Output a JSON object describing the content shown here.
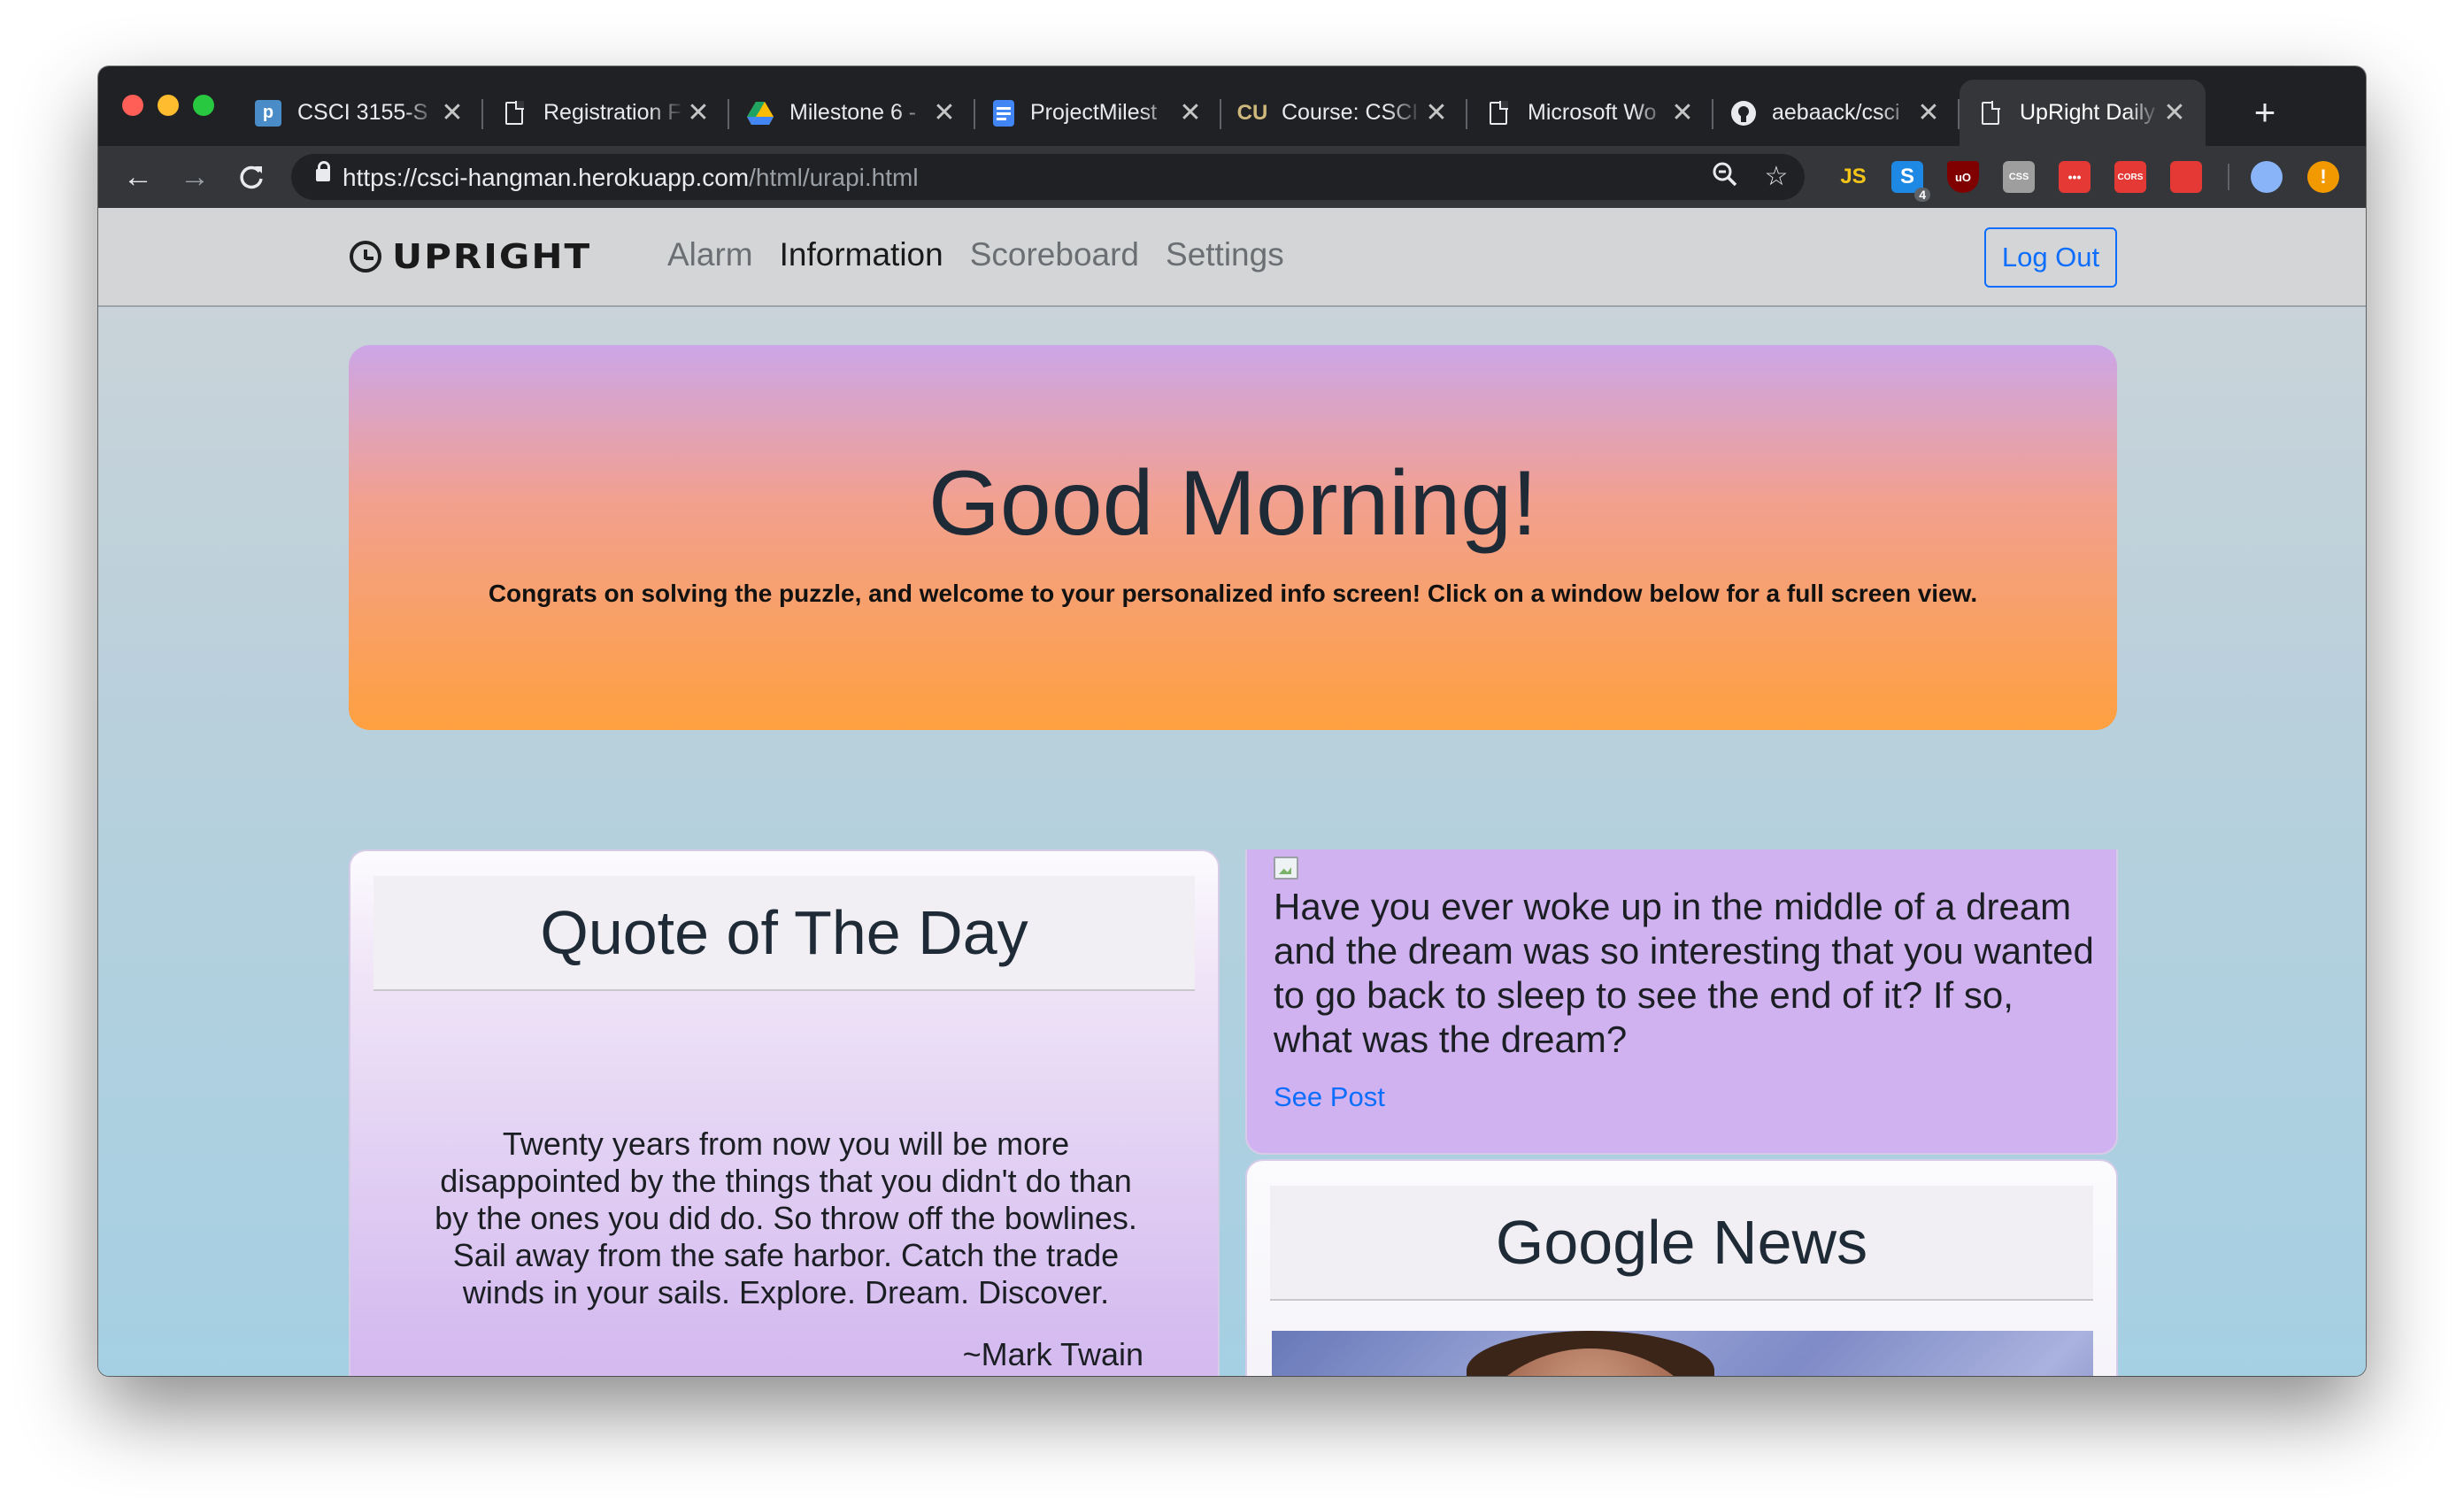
{
  "browser": {
    "tabs": [
      {
        "title": "CSCI 3155-S",
        "icon": "piazza-icon",
        "active": false
      },
      {
        "title": "Registration F",
        "icon": "document-icon",
        "active": false
      },
      {
        "title": "Milestone 6 -",
        "icon": "google-drive-icon",
        "active": false
      },
      {
        "title": "ProjectMilest",
        "icon": "google-docs-icon",
        "active": false
      },
      {
        "title": "Course: CSCI",
        "icon": "cu-boulder-icon",
        "active": false
      },
      {
        "title": "Microsoft Wo",
        "icon": "document-icon",
        "active": false
      },
      {
        "title": "aebaack/csci",
        "icon": "github-icon",
        "active": false
      },
      {
        "title": "UpRight Daily",
        "icon": "document-icon",
        "active": true
      }
    ],
    "tab_close_glyph": "✕",
    "new_tab_glyph": "+",
    "url_host": "https://csci-hangman.herokuapp.com",
    "url_path": "/html/urapi.html",
    "extensions": [
      {
        "name": "js-extension-icon",
        "label": "JS",
        "color": "#f5c518"
      },
      {
        "name": "s-extension-icon",
        "label": "S",
        "badge": "4",
        "color": "#1e88e5"
      },
      {
        "name": "ublock-icon",
        "label": "uO",
        "color": "#800000"
      },
      {
        "name": "css-extension-icon",
        "label": "CSS",
        "color": "#9e9e9e"
      },
      {
        "name": "more-extension-icon",
        "label": "•••",
        "color": "#e53935"
      },
      {
        "name": "cors-extension-icon",
        "label": "CORS",
        "color": "#e53935"
      },
      {
        "name": "red-extension-icon",
        "label": "",
        "color": "#e53935"
      }
    ]
  },
  "navbar": {
    "brand": "UPRIGHT",
    "links": [
      {
        "label": "Alarm",
        "active": false
      },
      {
        "label": "Information",
        "active": true
      },
      {
        "label": "Scoreboard",
        "active": false
      },
      {
        "label": "Settings",
        "active": false
      }
    ],
    "logout_label": "Log Out"
  },
  "hero": {
    "title": "Good Morning!",
    "subtitle": "Congrats on solving the puzzle, and welcome to your personalized info screen! Click on a window below for a full screen view."
  },
  "quote_card": {
    "heading": "Quote of The Day",
    "quote": "Twenty years from now you will be more disappointed by the things that you didn't do than by the ones you did do. So throw off the bowlines. Sail away from the safe harbor. Catch the trade winds in your sails. Explore. Dream. Discover.",
    "author": "~Mark Twain"
  },
  "reddit_card": {
    "text": "Have you ever woke up in the middle of a dream and the dream was so interesting that you wanted to go back to sleep to see the end of it? If so, what was the dream?",
    "link_label": "See Post"
  },
  "news_card": {
    "heading": "Google News"
  },
  "colors": {
    "accent": "#0d6efd",
    "hero_top": "#cca6e8",
    "hero_bottom": "#ffa040",
    "card_purple": "#d0b2f0"
  }
}
